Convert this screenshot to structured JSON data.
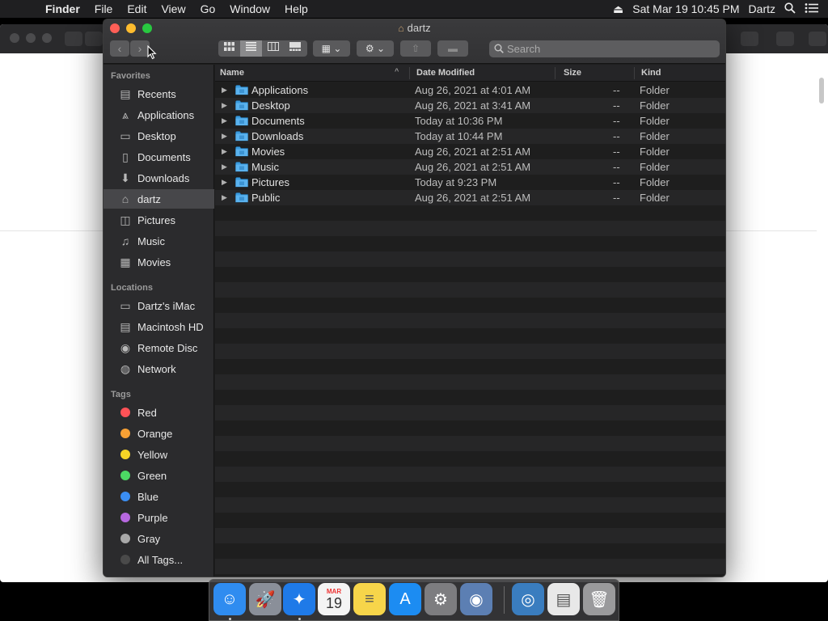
{
  "menubar": {
    "app_name": "Finder",
    "menus": [
      "File",
      "Edit",
      "View",
      "Go",
      "Window",
      "Help"
    ],
    "datetime": "Sat Mar 19  10:45 PM",
    "user": "Dartz"
  },
  "window": {
    "title": "dartz",
    "search_placeholder": "Search"
  },
  "sidebar": {
    "favorites_header": "Favorites",
    "favorites": [
      {
        "label": "Recents",
        "icon": "clock-icon"
      },
      {
        "label": "Applications",
        "icon": "applications-icon"
      },
      {
        "label": "Desktop",
        "icon": "desktop-icon"
      },
      {
        "label": "Documents",
        "icon": "documents-icon"
      },
      {
        "label": "Downloads",
        "icon": "downloads-icon"
      },
      {
        "label": "dartz",
        "icon": "home-icon",
        "active": true
      },
      {
        "label": "Pictures",
        "icon": "pictures-icon"
      },
      {
        "label": "Music",
        "icon": "music-icon"
      },
      {
        "label": "Movies",
        "icon": "movies-icon"
      }
    ],
    "locations_header": "Locations",
    "locations": [
      {
        "label": "Dartz's iMac",
        "icon": "computer-icon"
      },
      {
        "label": "Macintosh HD",
        "icon": "disk-icon"
      },
      {
        "label": "Remote Disc",
        "icon": "disc-icon"
      },
      {
        "label": "Network",
        "icon": "network-icon"
      }
    ],
    "tags_header": "Tags",
    "tags": [
      {
        "label": "Red",
        "color": "#ff5257"
      },
      {
        "label": "Orange",
        "color": "#f7a034"
      },
      {
        "label": "Yellow",
        "color": "#f6d426"
      },
      {
        "label": "Green",
        "color": "#4cd964"
      },
      {
        "label": "Blue",
        "color": "#3b8ef2"
      },
      {
        "label": "Purple",
        "color": "#b768e0"
      },
      {
        "label": "Gray",
        "color": "#a8a8a8"
      },
      {
        "label": "All Tags...",
        "color": "#4a4a4a"
      }
    ]
  },
  "columns": {
    "name": "Name",
    "date": "Date Modified",
    "size": "Size",
    "kind": "Kind"
  },
  "files": [
    {
      "name": "Applications",
      "date": "Aug 26, 2021 at 4:01 AM",
      "size": "--",
      "kind": "Folder"
    },
    {
      "name": "Desktop",
      "date": "Aug 26, 2021 at 3:41 AM",
      "size": "--",
      "kind": "Folder"
    },
    {
      "name": "Documents",
      "date": "Today at 10:36 PM",
      "size": "--",
      "kind": "Folder"
    },
    {
      "name": "Downloads",
      "date": "Today at 10:44 PM",
      "size": "--",
      "kind": "Folder"
    },
    {
      "name": "Movies",
      "date": "Aug 26, 2021 at 2:51 AM",
      "size": "--",
      "kind": "Folder"
    },
    {
      "name": "Music",
      "date": "Aug 26, 2021 at 2:51 AM",
      "size": "--",
      "kind": "Folder"
    },
    {
      "name": "Pictures",
      "date": "Today at 9:23 PM",
      "size": "--",
      "kind": "Folder"
    },
    {
      "name": "Public",
      "date": "Aug 26, 2021 at 2:51 AM",
      "size": "--",
      "kind": "Folder"
    }
  ],
  "dock": {
    "calendar_month": "MAR",
    "calendar_day": "19",
    "items": [
      {
        "name": "finder",
        "bg": "#2f8cf0",
        "glyph": "☺",
        "running": true
      },
      {
        "name": "launchpad",
        "bg": "#8a8f99",
        "glyph": "🚀",
        "running": false
      },
      {
        "name": "safari",
        "bg": "#1f7ae8",
        "glyph": "✦",
        "running": true
      },
      {
        "name": "calendar",
        "bg": "#f4f4f4",
        "glyph": "",
        "running": false
      },
      {
        "name": "notes",
        "bg": "#f7d54a",
        "glyph": "≡",
        "running": false
      },
      {
        "name": "app-store",
        "bg": "#1c8cf2",
        "glyph": "A",
        "running": false
      },
      {
        "name": "system-preferences",
        "bg": "#7d7d80",
        "glyph": "⚙",
        "running": false
      },
      {
        "name": "utility",
        "bg": "#5c7fb3",
        "glyph": "◉",
        "running": false
      },
      {
        "name": "downloads-stack",
        "bg": "#3a7dbf",
        "glyph": "◎",
        "running": false
      },
      {
        "name": "documents-stack",
        "bg": "#e8e8e8",
        "glyph": "▤",
        "running": false
      },
      {
        "name": "trash",
        "bg": "#9a9a9c",
        "glyph": "🗑",
        "running": false
      }
    ]
  }
}
